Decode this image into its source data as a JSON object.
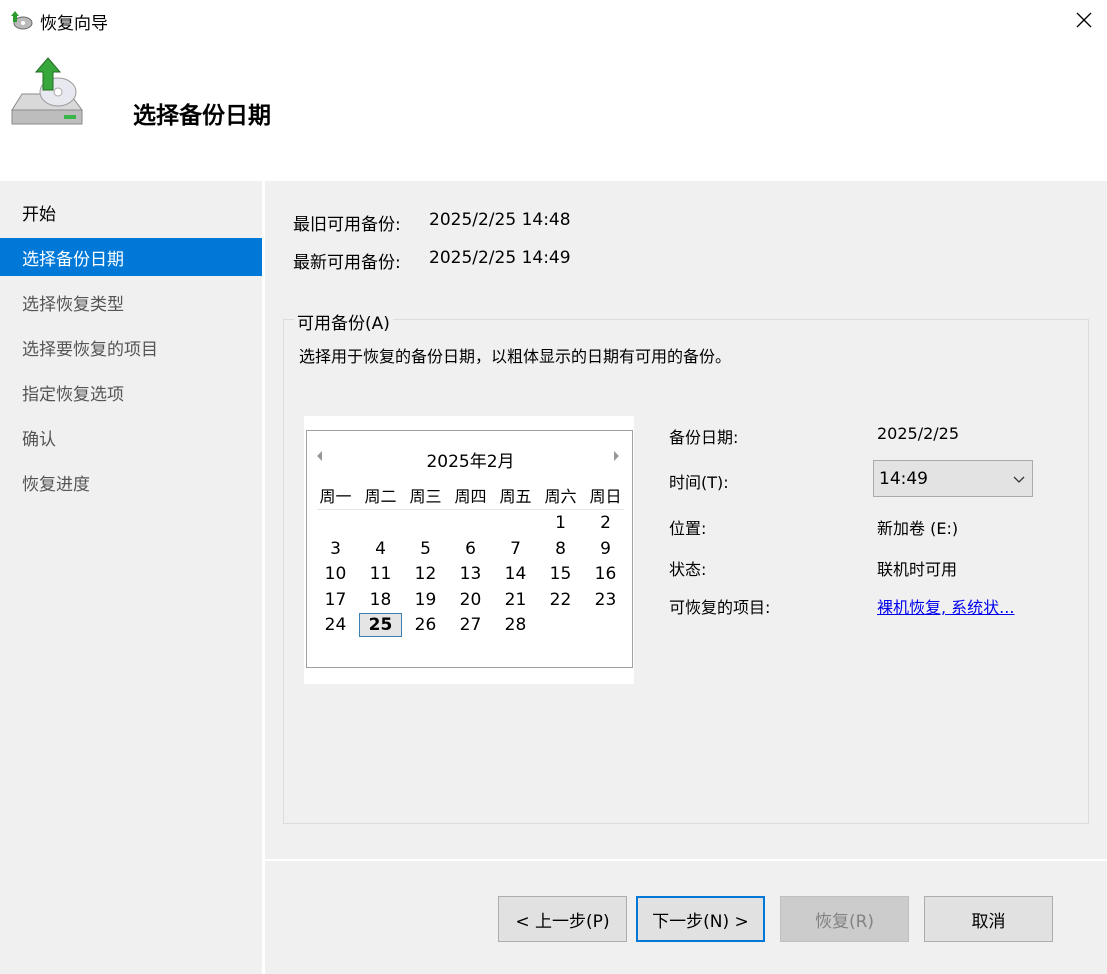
{
  "window": {
    "title": "恢复向导",
    "close_icon": "close-icon",
    "app_icon": "backup-restore-icon"
  },
  "header": {
    "title": "选择备份日期",
    "icon": "backup-drive-icon"
  },
  "sidebar": {
    "items": [
      {
        "label": "开始"
      },
      {
        "label": "选择备份日期"
      },
      {
        "label": "选择恢复类型"
      },
      {
        "label": "选择要恢复的项目"
      },
      {
        "label": "指定恢复选项"
      },
      {
        "label": "确认"
      },
      {
        "label": "恢复进度"
      }
    ],
    "active_index": 1
  },
  "info": {
    "oldest_label": "最旧可用备份:",
    "oldest_value": "2025/2/25 14:48",
    "newest_label": "最新可用备份:",
    "newest_value": "2025/2/25 14:49"
  },
  "group": {
    "legend": "可用备份(A)",
    "description": "选择用于恢复的备份日期，以粗体显示的日期有可用的备份。"
  },
  "calendar": {
    "title": "2025年2月",
    "weekdays": [
      "周一",
      "周二",
      "周三",
      "周四",
      "周五",
      "周六",
      "周日"
    ],
    "leading_blanks": 5,
    "days": [
      "1",
      "2",
      "3",
      "4",
      "5",
      "6",
      "7",
      "8",
      "9",
      "10",
      "11",
      "12",
      "13",
      "14",
      "15",
      "16",
      "17",
      "18",
      "19",
      "20",
      "21",
      "22",
      "23",
      "24",
      "25",
      "26",
      "27",
      "28"
    ],
    "selected_day": "25",
    "prev_icon": "triangle-left-icon",
    "next_icon": "triangle-right-icon"
  },
  "details": {
    "date_label": "备份日期:",
    "date_value": "2025/2/25",
    "time_label": "时间(T):",
    "time_value": "14:49",
    "location_label": "位置:",
    "location_value": "新加卷 (E:)",
    "status_label": "状态:",
    "status_value": "联机时可用",
    "items_label": "可恢复的项目:",
    "items_link": "裸机恢复, 系统状..."
  },
  "buttons": {
    "back": "< 上一步(P)",
    "next": "下一步(N) >",
    "recover": "恢复(R)",
    "cancel": "取消"
  },
  "colors": {
    "accent": "#0078d7",
    "link": "#0000ee",
    "panel": "#f0f0f0"
  }
}
